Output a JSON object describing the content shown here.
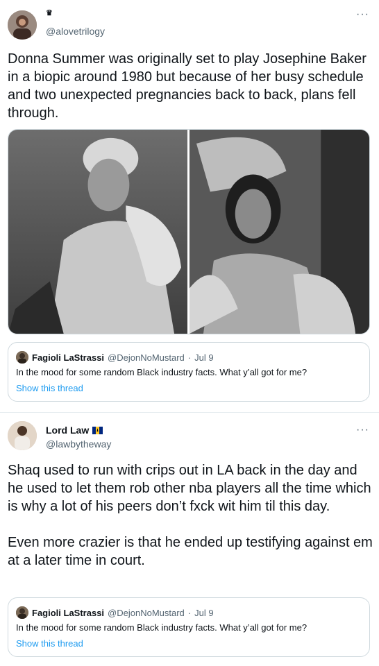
{
  "tweets": [
    {
      "display_name": "♛",
      "handle": "@alovetrilogy",
      "more_label": "···",
      "text": "Donna Summer was originally set to play Josephine Baker in a biopic around 1980 but because of her busy schedule and two unexpected pregnancies back to back, plans fell through.",
      "media": [
        "Black and white photo of Josephine Baker in a cloche hat and fur collar",
        "Black and white photo of Donna Summer in a beaded headpiece and feather boa"
      ],
      "quote": {
        "name": "Fagioli LaStrassi",
        "handle": "@DejonNoMustard",
        "separator": "·",
        "date": "Jul 9",
        "text": "In the mood for some random Black industry facts. What y’all got for me?",
        "link": "Show this thread"
      }
    },
    {
      "display_name": "Lord Law",
      "handle": "@lawbytheway",
      "more_label": "···",
      "text": "Shaq used to run with crips out in LA back in the day and he used to let them rob other nba players all the time which is why a lot of his peers don’t fxck wit him til this day.\n\nEven more crazier is that he ended up testifying against em at a later time in court.",
      "quote": {
        "name": "Fagioli LaStrassi",
        "handle": "@DejonNoMustard",
        "separator": "·",
        "date": "Jul 9",
        "text": "In the mood for some random Black industry facts. What y’all got for me?",
        "link": "Show this thread"
      }
    }
  ],
  "colors": {
    "link": "#1d9bf0",
    "border": "#cfd9de",
    "secondary_text": "#536471"
  }
}
